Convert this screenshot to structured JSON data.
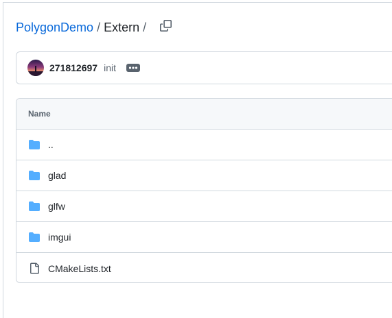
{
  "breadcrumb": {
    "repo": "PolygonDemo",
    "separator_1": "/",
    "folder": "Extern",
    "separator_2": "/"
  },
  "commit": {
    "author": "271812697",
    "message": "init"
  },
  "table": {
    "header_name": "Name",
    "rows": [
      {
        "name": "..",
        "type": "folder",
        "icon": "folder-icon"
      },
      {
        "name": "glad",
        "type": "folder",
        "icon": "folder-icon"
      },
      {
        "name": "glfw",
        "type": "folder",
        "icon": "folder-icon"
      },
      {
        "name": "imgui",
        "type": "folder",
        "icon": "folder-icon"
      },
      {
        "name": "CMakeLists.txt",
        "type": "file",
        "icon": "file-icon"
      }
    ]
  },
  "colors": {
    "link": "#0969da",
    "folder": "#54aeff",
    "border": "#d0d7de",
    "muted": "#59636e"
  }
}
